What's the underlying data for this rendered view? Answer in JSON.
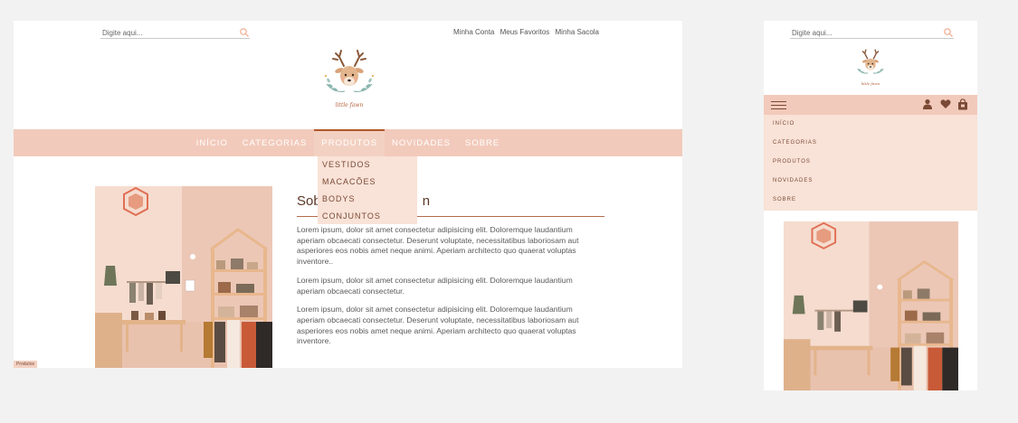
{
  "desktop": {
    "search": {
      "placeholder": "Digite aqui..."
    },
    "account_links": [
      "Minha Conta",
      "Meus Favoritos",
      "Minha Sacola"
    ],
    "logo_caption": "little fawn",
    "nav": [
      {
        "label": "INÍCIO"
      },
      {
        "label": "CATEGORIAS"
      },
      {
        "label": "PRODUTOS"
      },
      {
        "label": "NOVIDADES"
      },
      {
        "label": "SOBRE"
      }
    ],
    "dropdown": [
      "VESTIDOS",
      "MACACÕES",
      "BODYS",
      "CONJUNTOS"
    ],
    "about": {
      "title_visible": "Sob",
      "title_tail": "n",
      "paragraphs": [
        "Lorem ipsum, dolor sit amet consectetur adipisicing elit. Doloremque laudantium aperiam obcaecati consectetur. Deserunt voluptate, necessitatibus laboriosam aut asperiores eos nobis amet neque animi. Aperiam architecto quo quaerat voluptas inventore..",
        "Lorem ipsum, dolor sit amet consectetur adipisicing elit. Doloremque laudantium aperiam obcaecati consectetur.",
        "Lorem ipsum, dolor sit amet consectetur adipisicing elit. Doloremque laudantium aperiam obcaecati consectetur. Deserunt voluptate, necessitatibus laboriosam aut asperiores eos nobis amet neque animi. Aperiam architecto quo quaerat voluptas inventore."
      ]
    },
    "corner_tag": "Produtos"
  },
  "mobile": {
    "search": {
      "placeholder": "Digite aqui..."
    },
    "logo_caption": "little fawn",
    "menu": [
      "INÍCIO",
      "CATEGORIAS",
      "PRODUTOS",
      "NOVIDADES",
      "SOBRE"
    ],
    "icons": [
      "user-icon",
      "heart-icon",
      "bag-icon"
    ]
  },
  "colors": {
    "nav_bg": "#f2cabb",
    "dropdown_bg": "#f9e2d7",
    "accent": "#b0582b",
    "text": "#5a5a5a"
  }
}
